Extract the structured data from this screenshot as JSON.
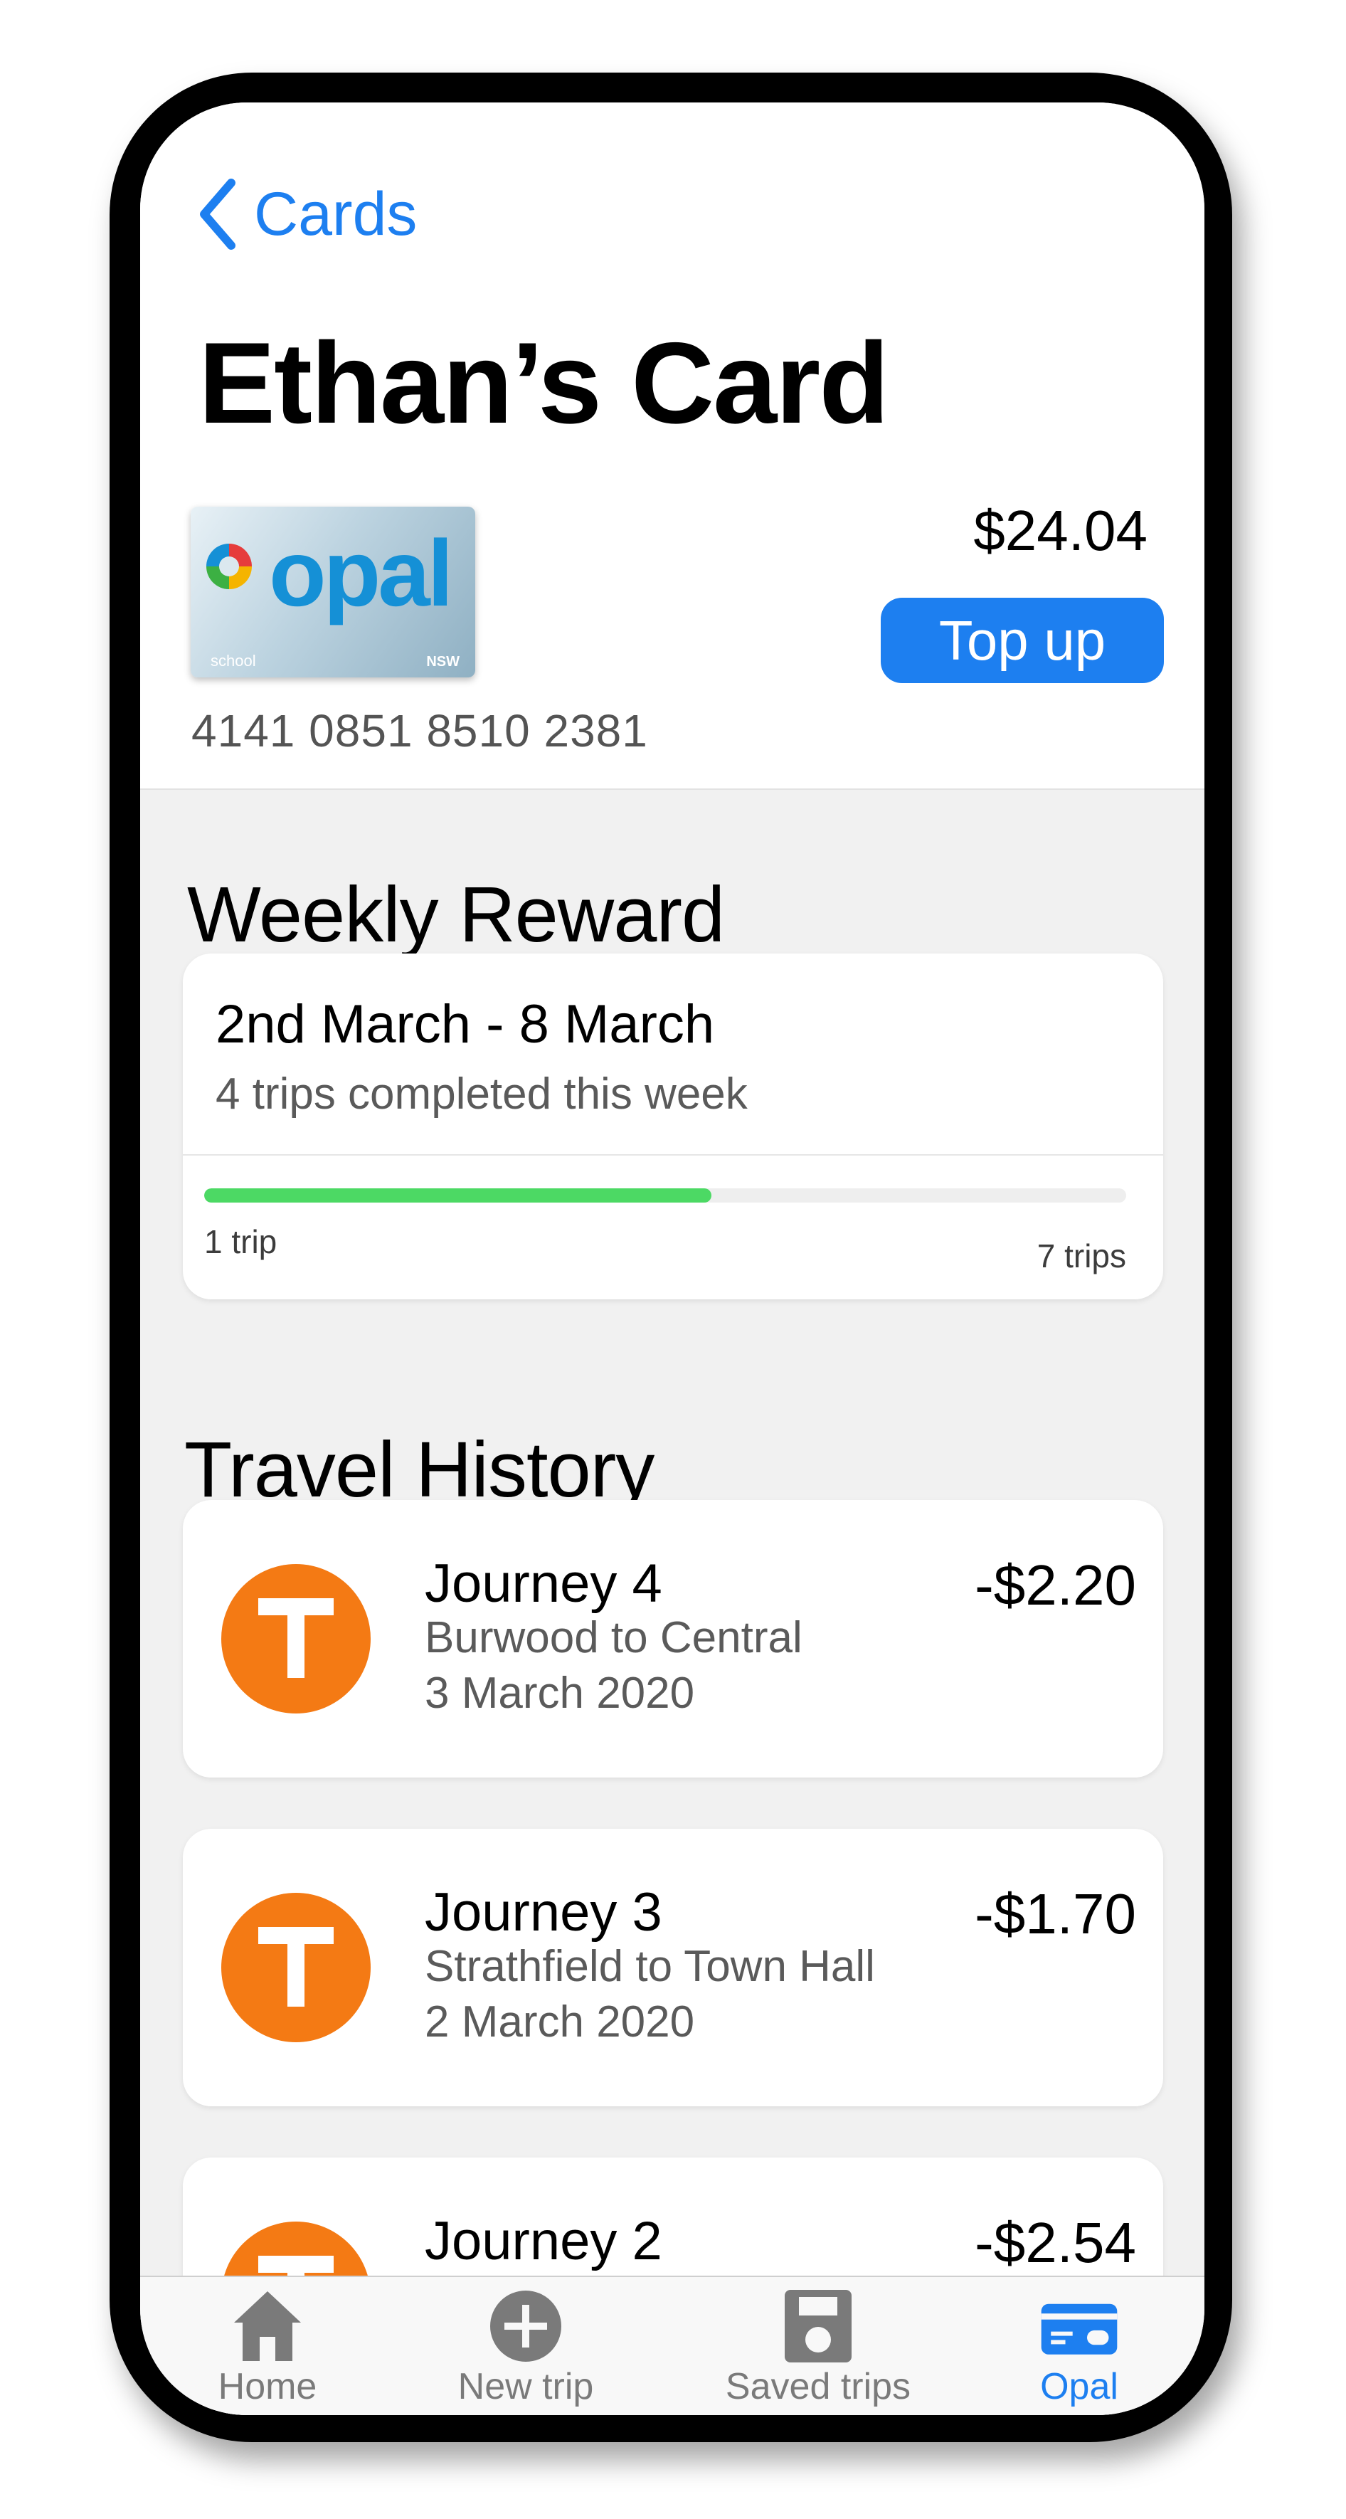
{
  "nav": {
    "back_label": "Cards"
  },
  "header": {
    "title": "Ethan’s Card"
  },
  "card": {
    "logo_text": "opal",
    "card_type": "school",
    "issuer_mark": "NSW",
    "number": "4141 0851 8510 2381",
    "balance": "$24.04",
    "topup_label": "Top up"
  },
  "weekly_reward": {
    "section_title": "Weekly Reward",
    "date_range": "2nd March - 8 March",
    "summary": "4 trips completed this week",
    "progress_fraction": 0.55,
    "range_min": "1 trip",
    "range_max": "7 trips",
    "progress_color": "#4cd964"
  },
  "travel_history": {
    "section_title": "Travel History",
    "journeys": [
      {
        "title": "Journey 4",
        "route": "Burwood to Central",
        "date": "3 March 2020",
        "amount": "-$2.20",
        "icon": "train-t-icon"
      },
      {
        "title": "Journey 3",
        "route": "Strathfield to Town Hall",
        "date": "2 March 2020",
        "amount": "-$1.70",
        "icon": "train-t-icon"
      },
      {
        "title": "Journey 2",
        "route": "",
        "date": "",
        "amount": "-$2.54",
        "icon": "train-t-icon"
      }
    ]
  },
  "tabbar": {
    "tabs": [
      {
        "label": "Home",
        "icon": "home-icon",
        "active": false
      },
      {
        "label": "New trip",
        "icon": "plus-circle-icon",
        "active": false
      },
      {
        "label": "Saved trips",
        "icon": "floppy-disk-icon",
        "active": false
      },
      {
        "label": "Opal",
        "icon": "card-icon",
        "active": true
      }
    ]
  },
  "colors": {
    "accent": "#1d7ff0",
    "train_orange": "#f47a14",
    "progress_green": "#4cd964"
  }
}
